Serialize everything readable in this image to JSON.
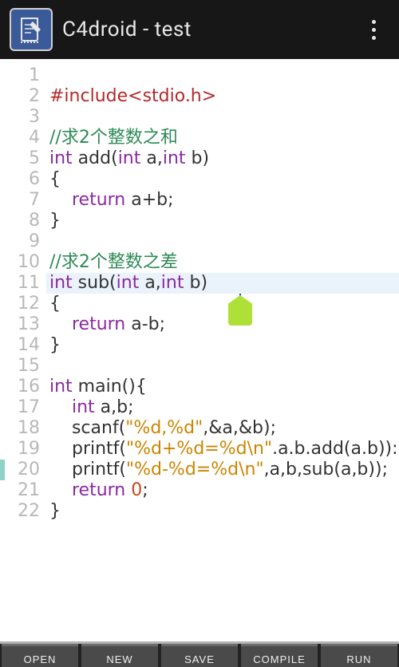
{
  "app_title": "C4droid - test",
  "lines": [
    {
      "n": 1,
      "tokens": []
    },
    {
      "n": 2,
      "tokens": [
        {
          "c": "pp",
          "t": "#include<stdio.h>"
        }
      ]
    },
    {
      "n": 3,
      "tokens": []
    },
    {
      "n": 4,
      "tokens": [
        {
          "c": "cm",
          "t": "//求2个整数之和"
        }
      ]
    },
    {
      "n": 5,
      "tokens": [
        {
          "c": "ty",
          "t": "int"
        },
        {
          "c": "id",
          "t": " add("
        },
        {
          "c": "ty",
          "t": "int"
        },
        {
          "c": "id",
          "t": " a,"
        },
        {
          "c": "ty",
          "t": "int"
        },
        {
          "c": "id",
          "t": " b)"
        }
      ]
    },
    {
      "n": 6,
      "tokens": [
        {
          "c": "brk",
          "t": "{"
        }
      ]
    },
    {
      "n": 7,
      "tokens": [
        {
          "c": "id",
          "t": "    "
        },
        {
          "c": "kw",
          "t": "return"
        },
        {
          "c": "id",
          "t": " a+b;"
        }
      ]
    },
    {
      "n": 8,
      "tokens": [
        {
          "c": "brk",
          "t": "}"
        }
      ]
    },
    {
      "n": 9,
      "tokens": []
    },
    {
      "n": 10,
      "tokens": [
        {
          "c": "cm",
          "t": "//求2个整数之差"
        }
      ]
    },
    {
      "n": 11,
      "highlight": true,
      "tokens": [
        {
          "c": "ty",
          "t": "int"
        },
        {
          "c": "id",
          "t": " sub("
        },
        {
          "c": "ty",
          "t": "int"
        },
        {
          "c": "id",
          "t": " a,"
        },
        {
          "c": "ty",
          "t": "int"
        },
        {
          "c": "id",
          "t": " b)"
        }
      ]
    },
    {
      "n": 12,
      "tokens": [
        {
          "c": "brk",
          "t": "{"
        }
      ]
    },
    {
      "n": 13,
      "tokens": [
        {
          "c": "id",
          "t": "    "
        },
        {
          "c": "kw",
          "t": "return"
        },
        {
          "c": "id",
          "t": " a-b;"
        }
      ]
    },
    {
      "n": 14,
      "tokens": [
        {
          "c": "brk",
          "t": "}"
        }
      ]
    },
    {
      "n": 15,
      "tokens": []
    },
    {
      "n": 16,
      "tokens": [
        {
          "c": "ty",
          "t": "int"
        },
        {
          "c": "id",
          "t": " main(){"
        }
      ]
    },
    {
      "n": 17,
      "tokens": [
        {
          "c": "id",
          "t": "    "
        },
        {
          "c": "ty",
          "t": "int"
        },
        {
          "c": "id",
          "t": " a,b;"
        }
      ]
    },
    {
      "n": 18,
      "tokens": [
        {
          "c": "id",
          "t": "    scanf("
        },
        {
          "c": "str",
          "t": "\"%d,%d\""
        },
        {
          "c": "id",
          "t": ",&a,&b);"
        }
      ]
    },
    {
      "n": 19,
      "tokens": [
        {
          "c": "id",
          "t": "    printf("
        },
        {
          "c": "str",
          "t": "\"%d+%d=%d\\n\""
        },
        {
          "c": "id",
          "t": ".a.b.add(a.b)):"
        }
      ]
    },
    {
      "n": 20,
      "indent_hint": true,
      "tokens": [
        {
          "c": "id",
          "t": "    printf("
        },
        {
          "c": "str",
          "t": "\"%d-%d=%d\\n\""
        },
        {
          "c": "id",
          "t": ",a,b,sub(a,b));"
        }
      ]
    },
    {
      "n": 21,
      "tokens": [
        {
          "c": "id",
          "t": "    "
        },
        {
          "c": "kw",
          "t": "return"
        },
        {
          "c": "id",
          "t": " "
        },
        {
          "c": "num",
          "t": "0"
        },
        {
          "c": "id",
          "t": ";"
        }
      ]
    },
    {
      "n": 22,
      "tokens": [
        {
          "c": "brk",
          "t": "}"
        }
      ]
    }
  ],
  "buttons": {
    "open": "OPEN",
    "new": "NEW",
    "save": "SAVE",
    "compile": "COMPILE",
    "run": "RUN"
  }
}
